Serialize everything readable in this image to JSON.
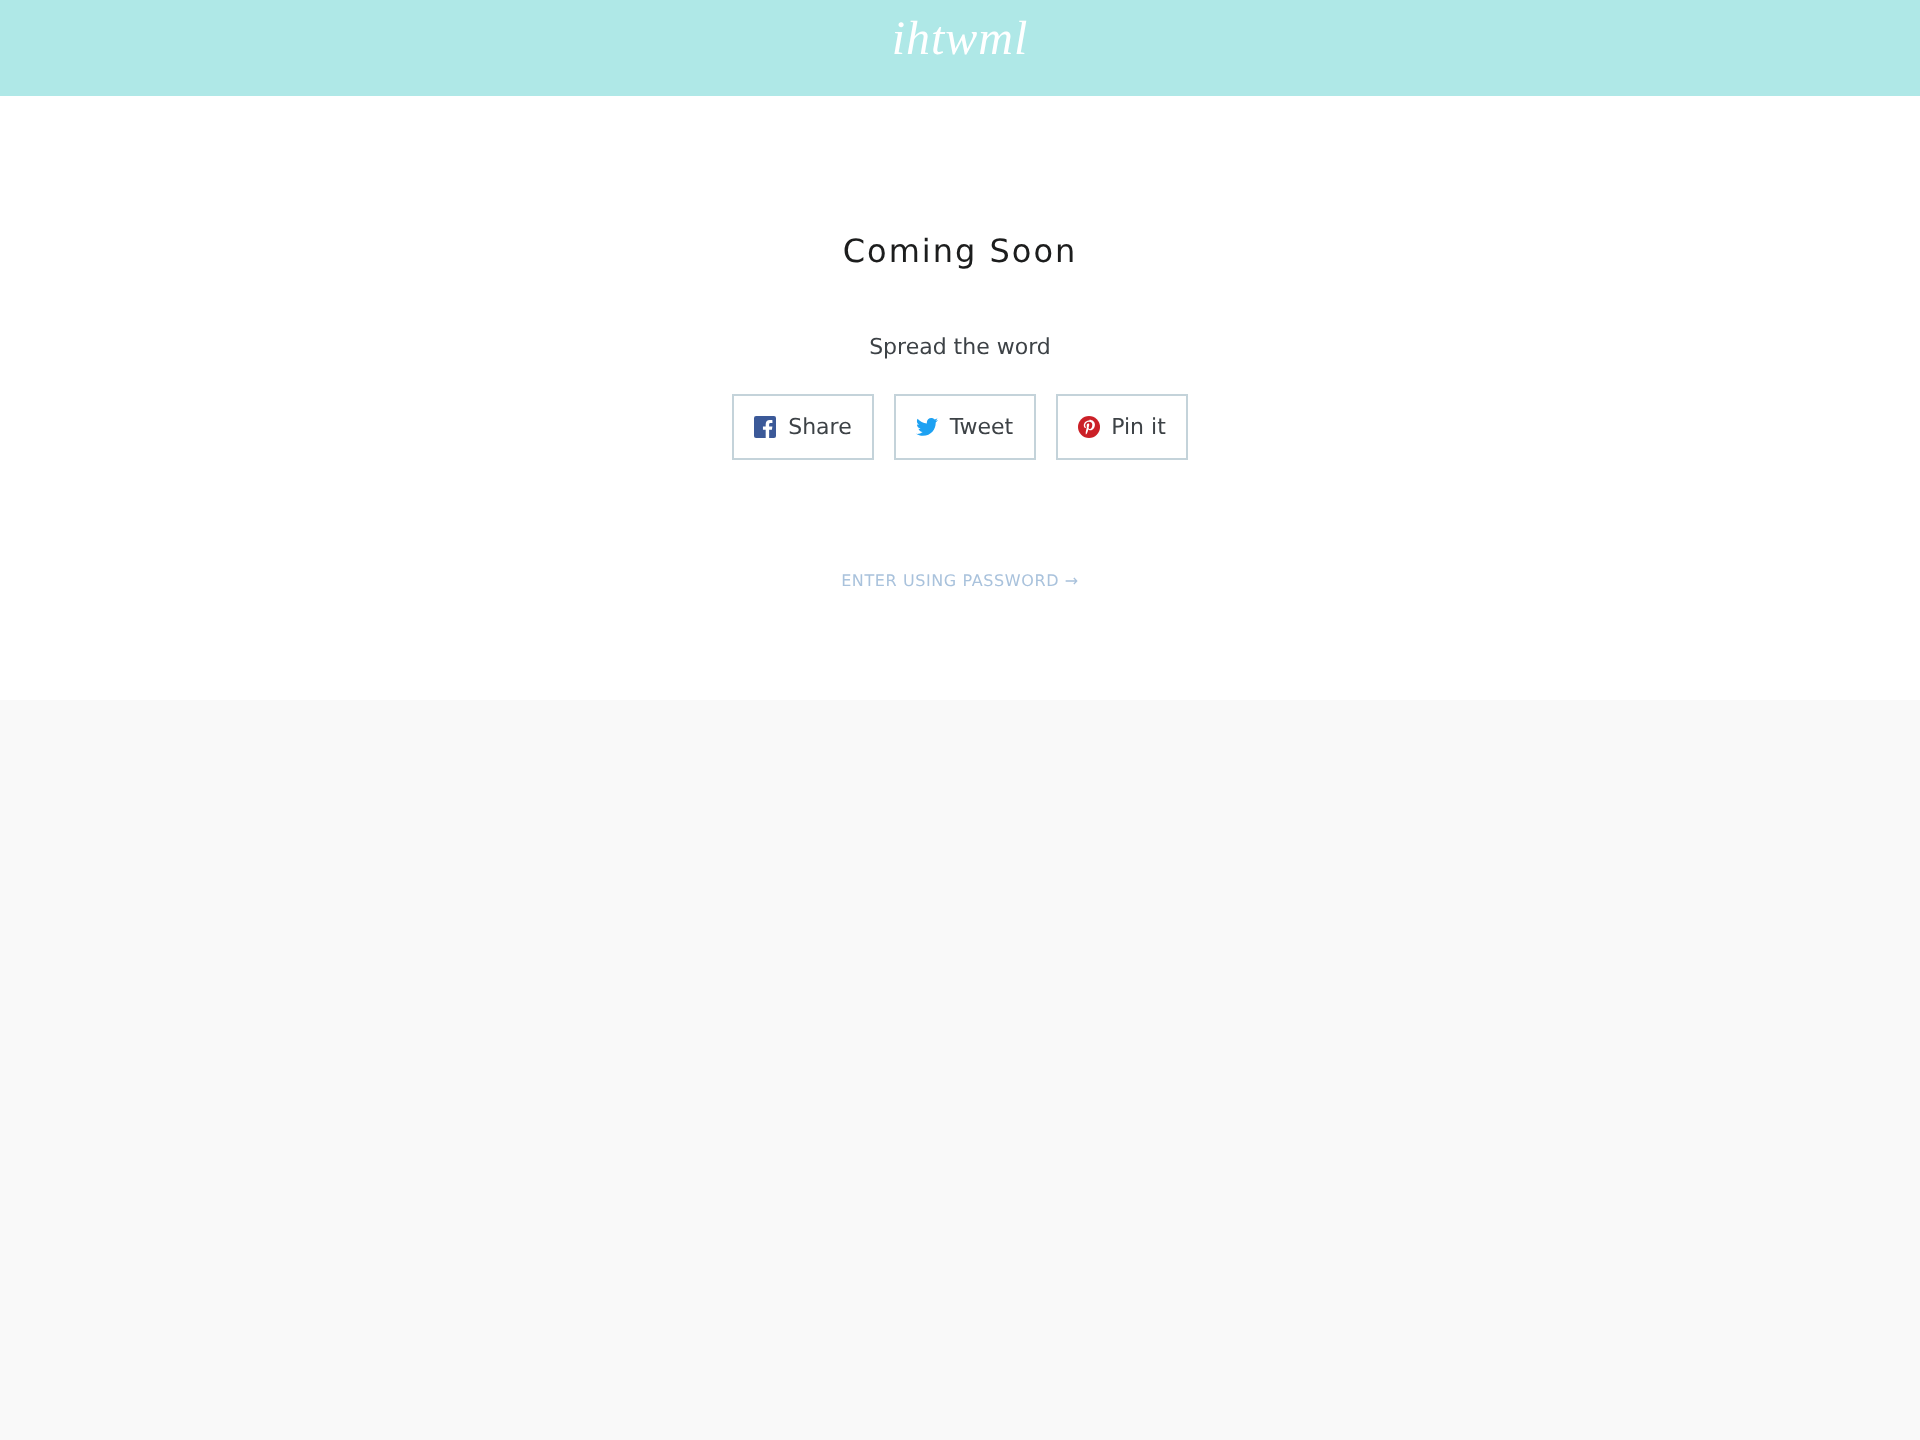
{
  "header": {
    "logo": "ihtwml"
  },
  "main": {
    "title": "Coming Soon",
    "share_label": "Spread the word",
    "share_buttons": [
      {
        "kind": "facebook",
        "label": "Share"
      },
      {
        "kind": "twitter",
        "label": "Tweet"
      },
      {
        "kind": "pinterest",
        "label": "Pin it"
      }
    ],
    "password_link": "ENTER USING PASSWORD →"
  }
}
